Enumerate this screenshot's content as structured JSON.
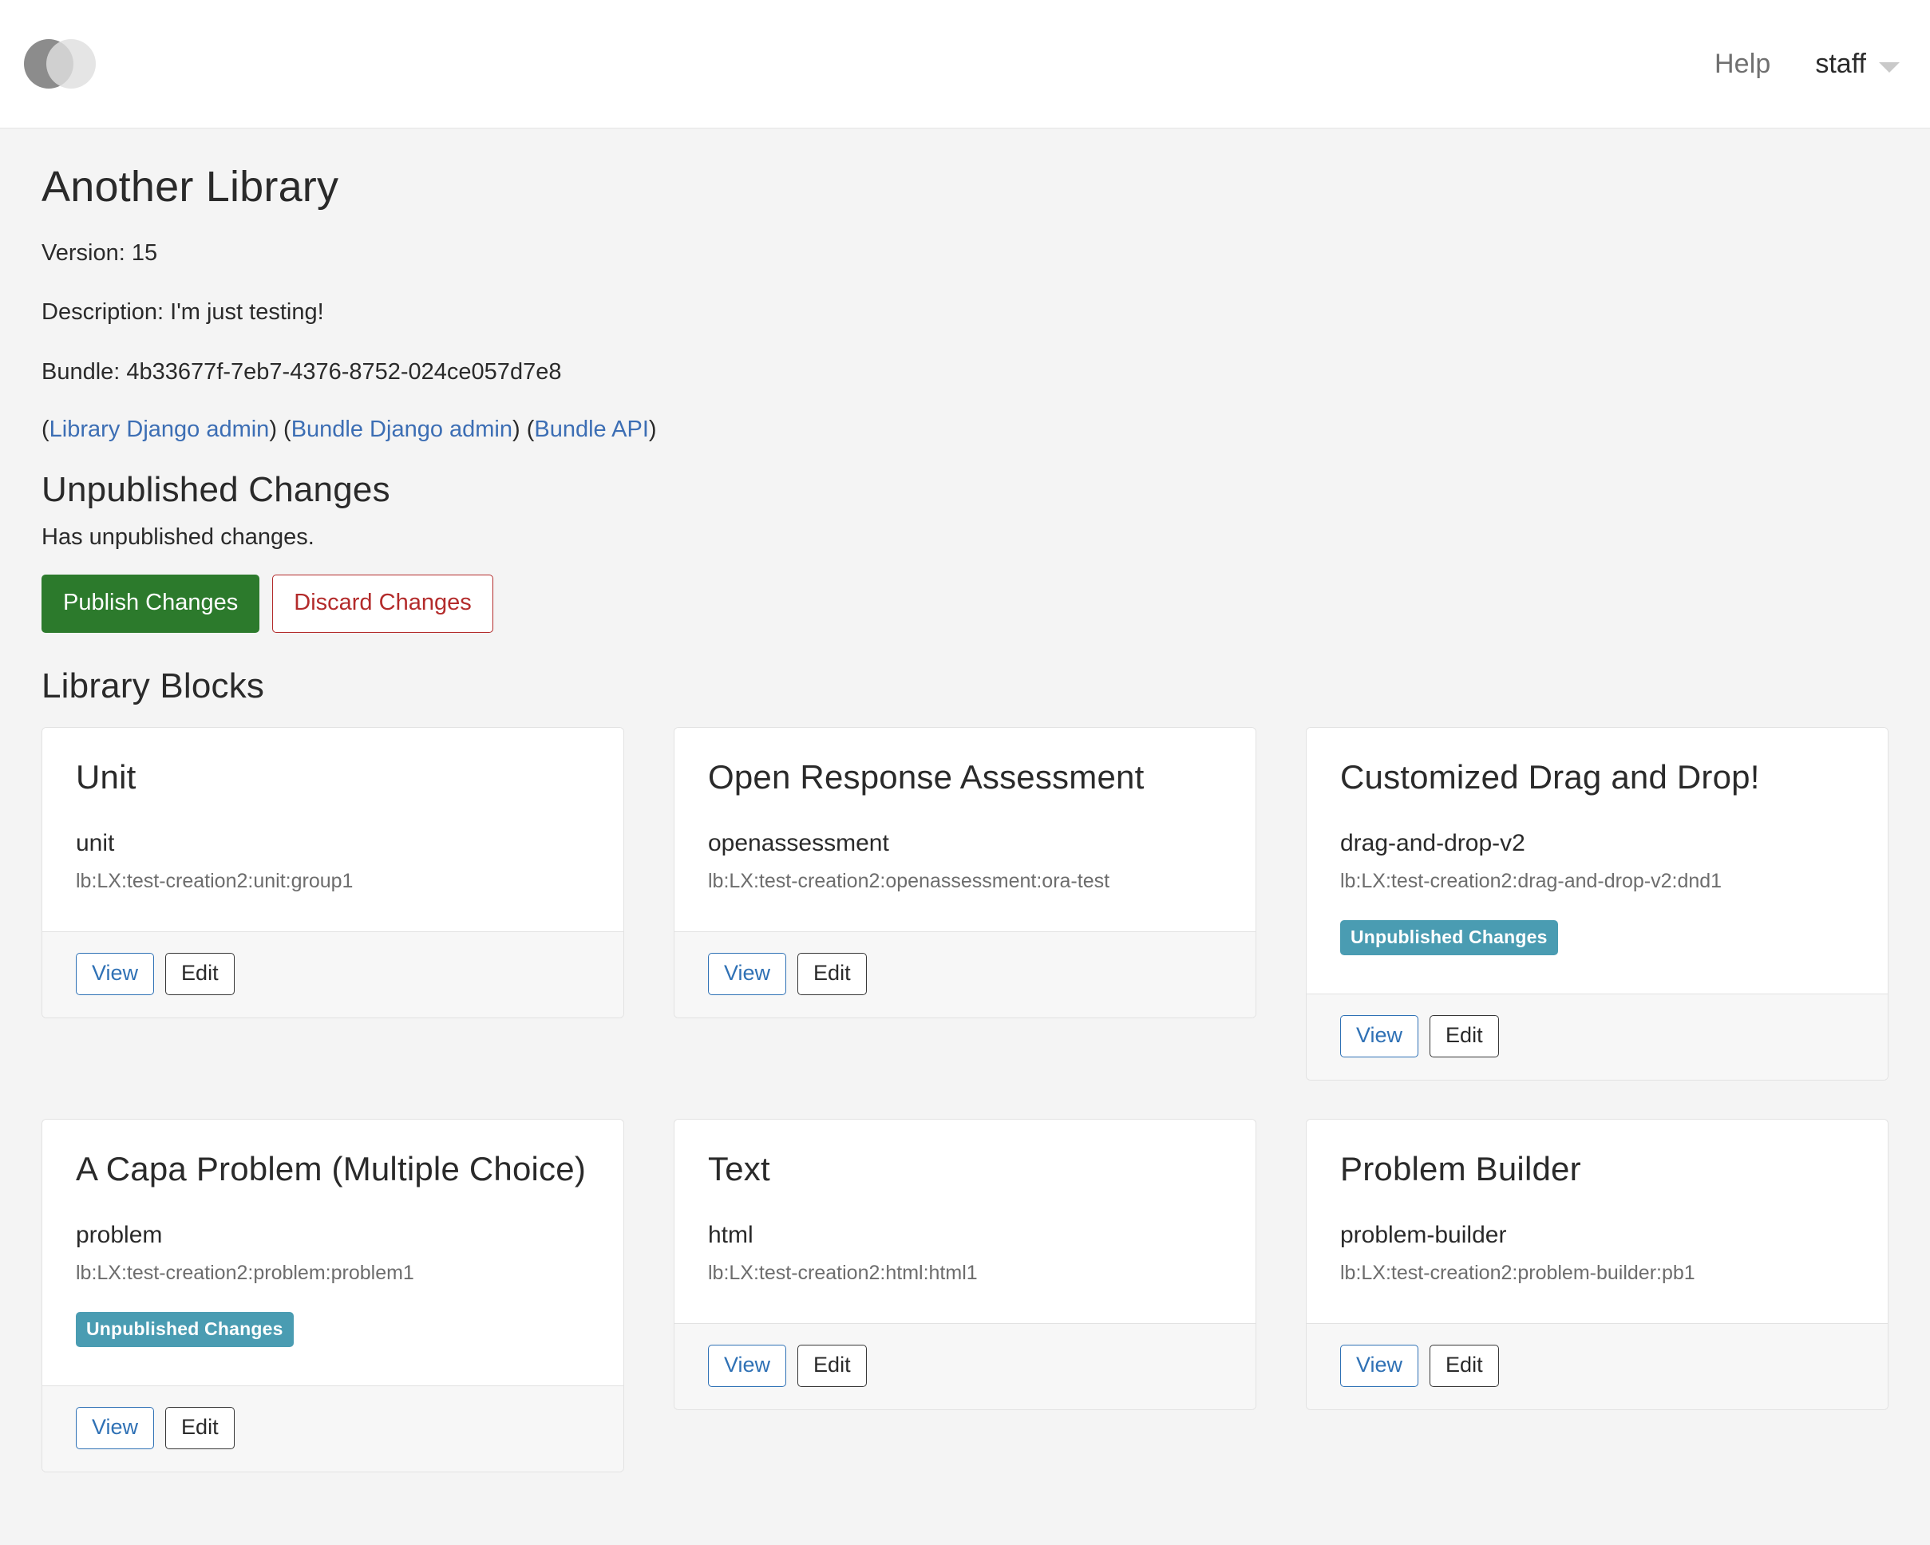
{
  "navbar": {
    "logo_name": "openedx-logo",
    "help_label": "Help",
    "user_label": "staff"
  },
  "library": {
    "title": "Another Library",
    "version_line": "Version: 15",
    "description_line": "Description: I'm just testing!",
    "bundle_line": "Bundle: 4b33677f-7eb7-4376-8752-024ce057d7e8",
    "links": [
      {
        "label": "Library Django admin"
      },
      {
        "label": "Bundle Django admin"
      },
      {
        "label": "Bundle API"
      }
    ]
  },
  "unpublished": {
    "heading": "Unpublished Changes",
    "status_text": "Has unpublished changes.",
    "publish_label": "Publish Changes",
    "discard_label": "Discard Changes",
    "publish_color": "#2c7a2c",
    "discard_color": "#b32b2b"
  },
  "blocks_section": {
    "heading": "Library Blocks",
    "badge_label": "Unpublished Changes",
    "badge_color": "#4a9cb2",
    "view_label": "View",
    "edit_label": "Edit",
    "blocks": [
      {
        "title": "Unit",
        "type": "unit",
        "usage_key": "lb:LX:test-creation2:unit:group1",
        "has_unpublished": false
      },
      {
        "title": "Open Response Assessment",
        "type": "openassessment",
        "usage_key": "lb:LX:test-creation2:openassessment:ora-test",
        "has_unpublished": false
      },
      {
        "title": "Customized Drag and Drop!",
        "type": "drag-and-drop-v2",
        "usage_key": "lb:LX:test-creation2:drag-and-drop-v2:dnd1",
        "has_unpublished": true
      },
      {
        "title": "A Capa Problem (Multiple Choice)",
        "type": "problem",
        "usage_key": "lb:LX:test-creation2:problem:problem1",
        "has_unpublished": true
      },
      {
        "title": "Text",
        "type": "html",
        "usage_key": "lb:LX:test-creation2:html:html1",
        "has_unpublished": false
      },
      {
        "title": "Problem Builder",
        "type": "problem-builder",
        "usage_key": "lb:LX:test-creation2:problem-builder:pb1",
        "has_unpublished": false
      }
    ]
  }
}
